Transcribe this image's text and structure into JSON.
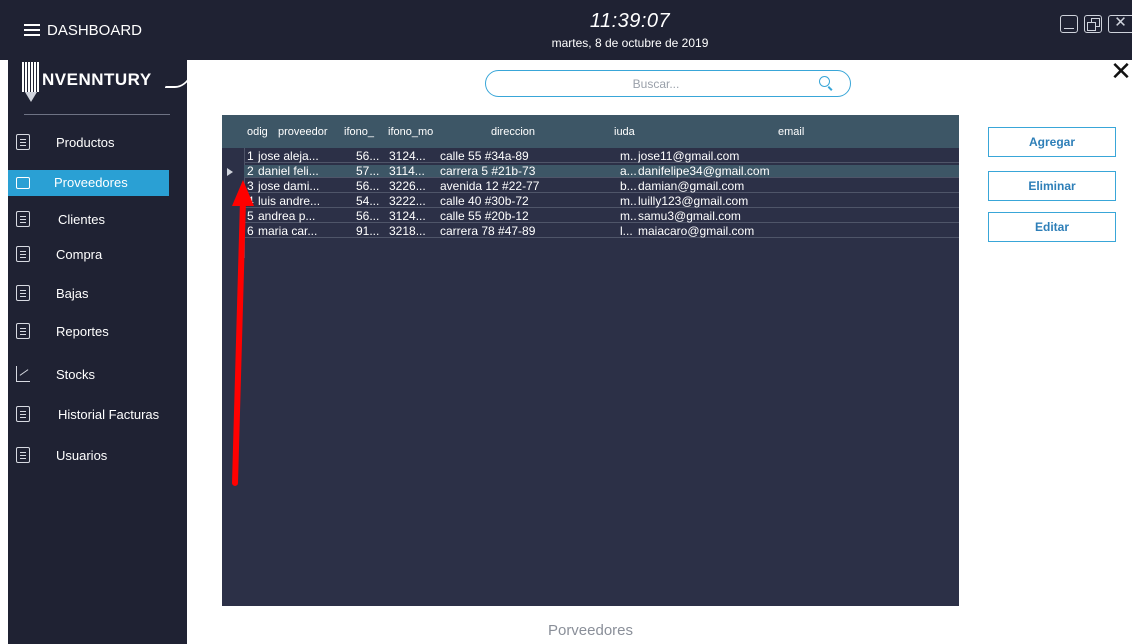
{
  "header": {
    "menu_label": "DASHBOARD",
    "time": "11:39:07",
    "date": "martes, 8 de octubre de 2019"
  },
  "logo": {
    "text": "NVENNTURY"
  },
  "sidebar": {
    "items": [
      {
        "label": "Productos",
        "icon": "product-icon"
      },
      {
        "label": "Proveedores",
        "icon": "truck-icon",
        "active": true
      },
      {
        "label": "Clientes",
        "icon": "client-icon"
      },
      {
        "label": "Compra",
        "icon": "purchase-icon"
      },
      {
        "label": "Bajas",
        "icon": "removal-icon"
      },
      {
        "label": "Reportes",
        "icon": "report-icon"
      },
      {
        "label": "Stocks",
        "icon": "stock-chart-icon"
      },
      {
        "label": "Historial Facturas",
        "icon": "invoice-history-icon"
      },
      {
        "label": "Usuarios",
        "icon": "user-icon"
      }
    ]
  },
  "search": {
    "placeholder": "Buscar..."
  },
  "table": {
    "columns": [
      "odig",
      "proveedor",
      "ifono_",
      "ifono_mo",
      "direccion",
      "iuda",
      "email"
    ],
    "rows": [
      [
        "1",
        "jose aleja...",
        "56...",
        "3124...",
        "calle 55 #34a-89",
        "m...",
        "jose11@gmail.com"
      ],
      [
        "2",
        "daniel feli...",
        "57...",
        "3114...",
        "carrera 5 #21b-73",
        "a...",
        "danifelipe34@gmail.com"
      ],
      [
        "3",
        "jose dami...",
        "56...",
        "3226...",
        "avenida 12 #22-77",
        "b...",
        "damian@gmail.com"
      ],
      [
        "4",
        "luis andre...",
        "54...",
        "3222...",
        "calle 40 #30b-72",
        "m...",
        "luilly123@gmail.com"
      ],
      [
        "5",
        "andrea p...",
        "56...",
        "3124...",
        "calle 55 #20b-12",
        "m...",
        "samu3@gmail.com"
      ],
      [
        "6",
        "maria car...",
        "91...",
        "3218...",
        "carrera 78 #47-89",
        "l...",
        "maiacaro@gmail.com"
      ]
    ],
    "selected_row": 2
  },
  "actions": {
    "add_label": "Agregar",
    "delete_label": "Eliminar",
    "edit_label": "Editar"
  },
  "footer": {
    "title": "Porveedores"
  },
  "colors": {
    "sidebar_bg": "#1f2233",
    "grid_bg": "#2c3047",
    "header_bg": "#3d5666",
    "accent": "#2aa0d4",
    "annotation_arrow": "#ff0000"
  }
}
